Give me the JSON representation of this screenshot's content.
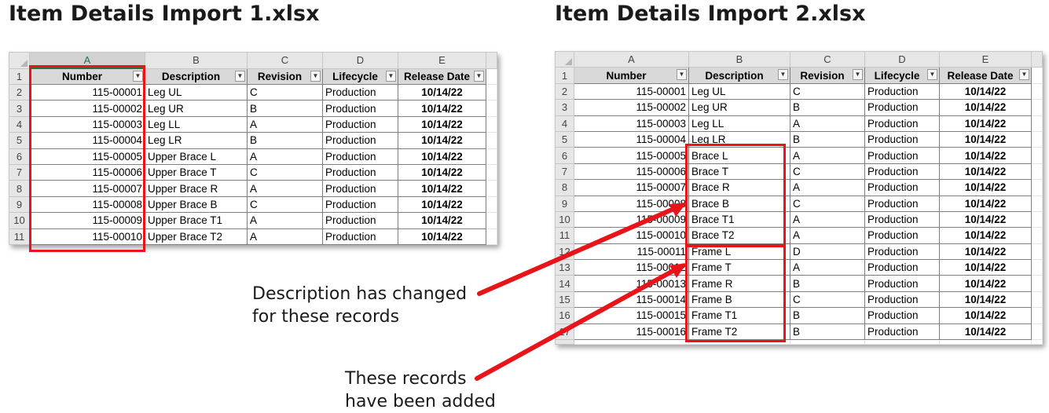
{
  "titles": {
    "left": "Item Details Import 1.xlsx",
    "right": "Item Details Import 2.xlsx"
  },
  "sheet_columns": [
    "A",
    "B",
    "C",
    "D",
    "E"
  ],
  "table_headers": [
    "Number",
    "Description",
    "Revision",
    "Lifecycle",
    "Release Date"
  ],
  "filter_glyph": "▼",
  "left_sheet": {
    "rows": [
      {
        "n": "2",
        "number": "115-00001",
        "description": "Leg UL",
        "revision": "C",
        "lifecycle": "Production",
        "release": "10/14/22"
      },
      {
        "n": "3",
        "number": "115-00002",
        "description": "Leg UR",
        "revision": "B",
        "lifecycle": "Production",
        "release": "10/14/22"
      },
      {
        "n": "4",
        "number": "115-00003",
        "description": "Leg LL",
        "revision": "A",
        "lifecycle": "Production",
        "release": "10/14/22"
      },
      {
        "n": "5",
        "number": "115-00004",
        "description": "Leg LR",
        "revision": "B",
        "lifecycle": "Production",
        "release": "10/14/22"
      },
      {
        "n": "6",
        "number": "115-00005",
        "description": "Upper Brace L",
        "revision": "A",
        "lifecycle": "Production",
        "release": "10/14/22"
      },
      {
        "n": "7",
        "number": "115-00006",
        "description": "Upper Brace T",
        "revision": "C",
        "lifecycle": "Production",
        "release": "10/14/22"
      },
      {
        "n": "8",
        "number": "115-00007",
        "description": "Upper Brace R",
        "revision": "A",
        "lifecycle": "Production",
        "release": "10/14/22"
      },
      {
        "n": "9",
        "number": "115-00008",
        "description": "Upper Brace B",
        "revision": "C",
        "lifecycle": "Production",
        "release": "10/14/22"
      },
      {
        "n": "10",
        "number": "115-00009",
        "description": "Upper Brace T1",
        "revision": "A",
        "lifecycle": "Production",
        "release": "10/14/22"
      },
      {
        "n": "11",
        "number": "115-00010",
        "description": "Upper Brace T2",
        "revision": "A",
        "lifecycle": "Production",
        "release": "10/14/22"
      }
    ]
  },
  "right_sheet": {
    "rows": [
      {
        "n": "2",
        "number": "115-00001",
        "description": "Leg UL",
        "revision": "C",
        "lifecycle": "Production",
        "release": "10/14/22"
      },
      {
        "n": "3",
        "number": "115-00002",
        "description": "Leg UR",
        "revision": "B",
        "lifecycle": "Production",
        "release": "10/14/22"
      },
      {
        "n": "4",
        "number": "115-00003",
        "description": "Leg LL",
        "revision": "A",
        "lifecycle": "Production",
        "release": "10/14/22"
      },
      {
        "n": "5",
        "number": "115-00004",
        "description": "Leg LR",
        "revision": "B",
        "lifecycle": "Production",
        "release": "10/14/22"
      },
      {
        "n": "6",
        "number": "115-00005",
        "description": "Brace L",
        "revision": "A",
        "lifecycle": "Production",
        "release": "10/14/22"
      },
      {
        "n": "7",
        "number": "115-00006",
        "description": "Brace T",
        "revision": "C",
        "lifecycle": "Production",
        "release": "10/14/22"
      },
      {
        "n": "8",
        "number": "115-00007",
        "description": "Brace R",
        "revision": "A",
        "lifecycle": "Production",
        "release": "10/14/22"
      },
      {
        "n": "9",
        "number": "115-00008",
        "description": "Brace B",
        "revision": "C",
        "lifecycle": "Production",
        "release": "10/14/22"
      },
      {
        "n": "10",
        "number": "115-00009",
        "description": "Brace T1",
        "revision": "A",
        "lifecycle": "Production",
        "release": "10/14/22"
      },
      {
        "n": "11",
        "number": "115-00010",
        "description": "Brace T2",
        "revision": "A",
        "lifecycle": "Production",
        "release": "10/14/22"
      },
      {
        "n": "12",
        "number": "115-00011",
        "description": "Frame L",
        "revision": "D",
        "lifecycle": "Production",
        "release": "10/14/22"
      },
      {
        "n": "13",
        "number": "115-00012",
        "description": "Frame T",
        "revision": "A",
        "lifecycle": "Production",
        "release": "10/14/22"
      },
      {
        "n": "14",
        "number": "115-00013",
        "description": "Frame R",
        "revision": "B",
        "lifecycle": "Production",
        "release": "10/14/22"
      },
      {
        "n": "15",
        "number": "115-00014",
        "description": "Frame B",
        "revision": "C",
        "lifecycle": "Production",
        "release": "10/14/22"
      },
      {
        "n": "16",
        "number": "115-00015",
        "description": "Frame T1",
        "revision": "B",
        "lifecycle": "Production",
        "release": "10/14/22"
      },
      {
        "n": "17",
        "number": "115-00016",
        "description": "Frame T2",
        "revision": "B",
        "lifecycle": "Production",
        "release": "10/14/22"
      }
    ]
  },
  "annotations": {
    "changed_line1": "Description has changed",
    "changed_line2": "for these records",
    "added_line1": "These records",
    "added_line2": "have been added"
  },
  "colors": {
    "highlight": "#e8141a",
    "header_fill": "#d9d9d9",
    "selected_column": "#217346"
  }
}
